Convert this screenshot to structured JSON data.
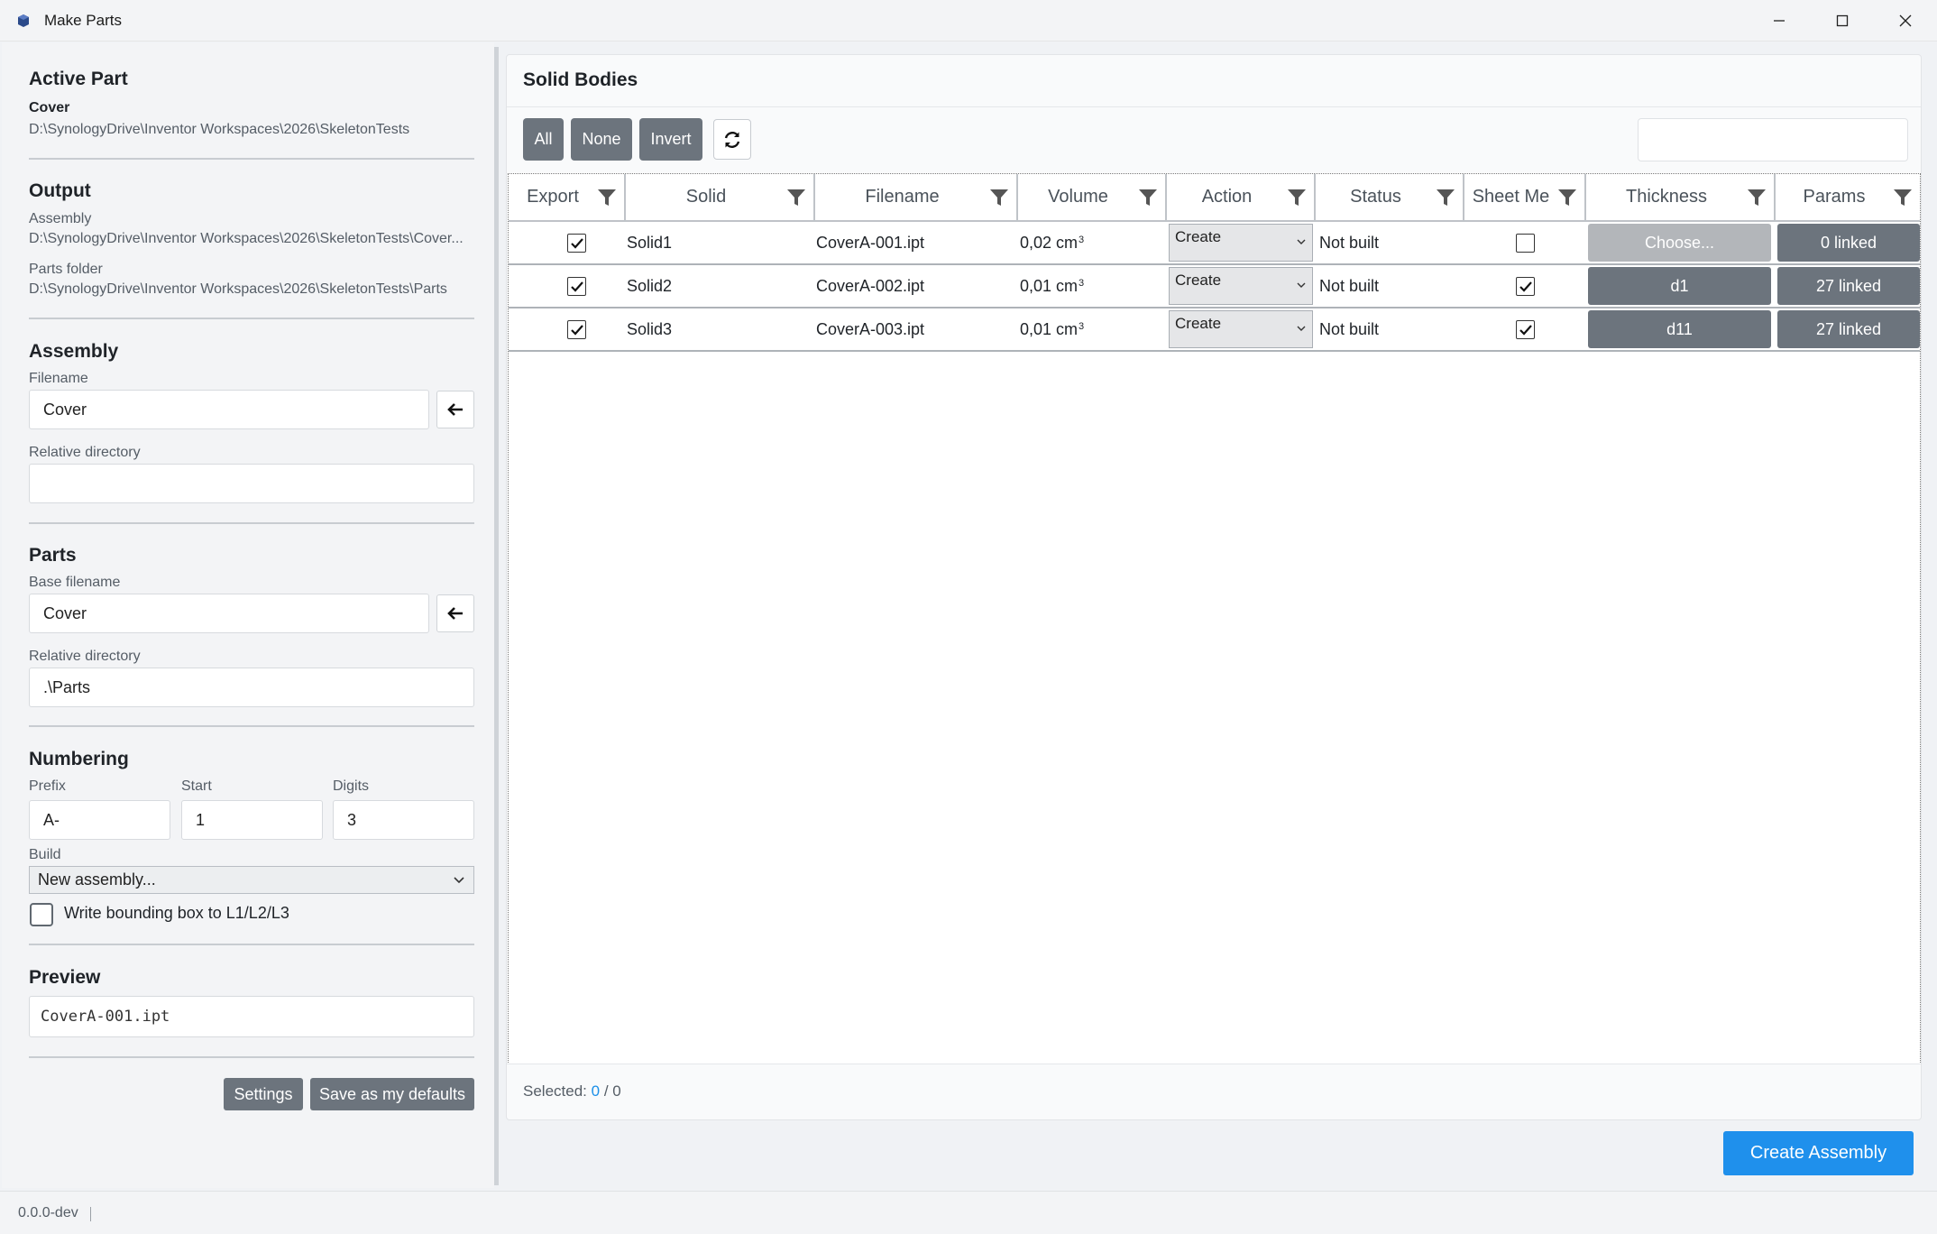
{
  "window": {
    "title": "Make Parts"
  },
  "active_part": {
    "heading": "Active Part",
    "name": "Cover",
    "path": "D:\\SynologyDrive\\Inventor Workspaces\\2026\\SkeletonTests"
  },
  "output": {
    "heading": "Output",
    "assembly_label": "Assembly",
    "assembly_path": "D:\\SynologyDrive\\Inventor Workspaces\\2026\\SkeletonTests\\Cover...",
    "parts_label": "Parts folder",
    "parts_path": "D:\\SynologyDrive\\Inventor Workspaces\\2026\\SkeletonTests\\Parts"
  },
  "assembly": {
    "heading": "Assembly",
    "filename_label": "Filename",
    "filename": "Cover",
    "reldir_label": "Relative directory",
    "reldir": ""
  },
  "parts": {
    "heading": "Parts",
    "base_label": "Base filename",
    "base": "Cover",
    "reldir_label": "Relative directory",
    "reldir": ".\\Parts"
  },
  "numbering": {
    "heading": "Numbering",
    "prefix_label": "Prefix",
    "prefix": "A-",
    "start_label": "Start",
    "start": "1",
    "digits_label": "Digits",
    "digits": "3",
    "build_label": "Build",
    "build": "New assembly...",
    "bbox_label": "Write bounding box to L1/L2/L3"
  },
  "preview": {
    "heading": "Preview",
    "value": "CoverA-001.ipt"
  },
  "footer_buttons": {
    "settings": "Settings",
    "save_defaults": "Save as my defaults"
  },
  "solid_bodies": {
    "title": "Solid Bodies",
    "toolbar": {
      "all": "All",
      "none": "None",
      "invert": "Invert"
    },
    "columns": [
      "Export",
      "Solid",
      "Filename",
      "Volume",
      "Action",
      "Status",
      "Sheet Me",
      "Thickness",
      "Params"
    ],
    "rows": [
      {
        "export": true,
        "solid": "Solid1",
        "filename": "CoverA-001.ipt",
        "volume": "0,02 cm",
        "unit_exp": "3",
        "action": "Create",
        "status": "Not built",
        "sheet": false,
        "thickness": "Choose...",
        "params": "0 linked"
      },
      {
        "export": true,
        "solid": "Solid2",
        "filename": "CoverA-002.ipt",
        "volume": "0,01 cm",
        "unit_exp": "3",
        "action": "Create",
        "status": "Not built",
        "sheet": true,
        "thickness": "d1",
        "params": "27 linked"
      },
      {
        "export": true,
        "solid": "Solid3",
        "filename": "CoverA-003.ipt",
        "volume": "0,01 cm",
        "unit_exp": "3",
        "action": "Create",
        "status": "Not built",
        "sheet": true,
        "thickness": "d11",
        "params": "27 linked"
      }
    ],
    "selected_label": "Selected:",
    "selected_count": "0",
    "selected_total": "/ 0"
  },
  "create_button": "Create Assembly",
  "status_bar": {
    "version": "0.0.0-dev"
  },
  "colors": {
    "accent": "#1f90ec",
    "button_dark": "#6c747d",
    "button_disabled": "#b3b6ba"
  }
}
